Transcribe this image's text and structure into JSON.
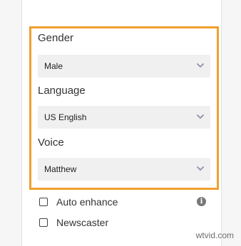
{
  "fields": {
    "gender": {
      "label": "Gender",
      "value": "Male"
    },
    "language": {
      "label": "Language",
      "value": "US English"
    },
    "voice": {
      "label": "Voice",
      "value": "Matthew"
    }
  },
  "options": {
    "auto_enhance": {
      "label": "Auto enhance",
      "checked": false
    },
    "newscaster": {
      "label": "Newscaster",
      "checked": false
    }
  },
  "icons": {
    "dropdown": "chevron-down-icon",
    "info": "info-icon"
  },
  "colors": {
    "highlight": "#f0a030",
    "chevron": "#8a90a8"
  },
  "watermark": "wtvid.com"
}
